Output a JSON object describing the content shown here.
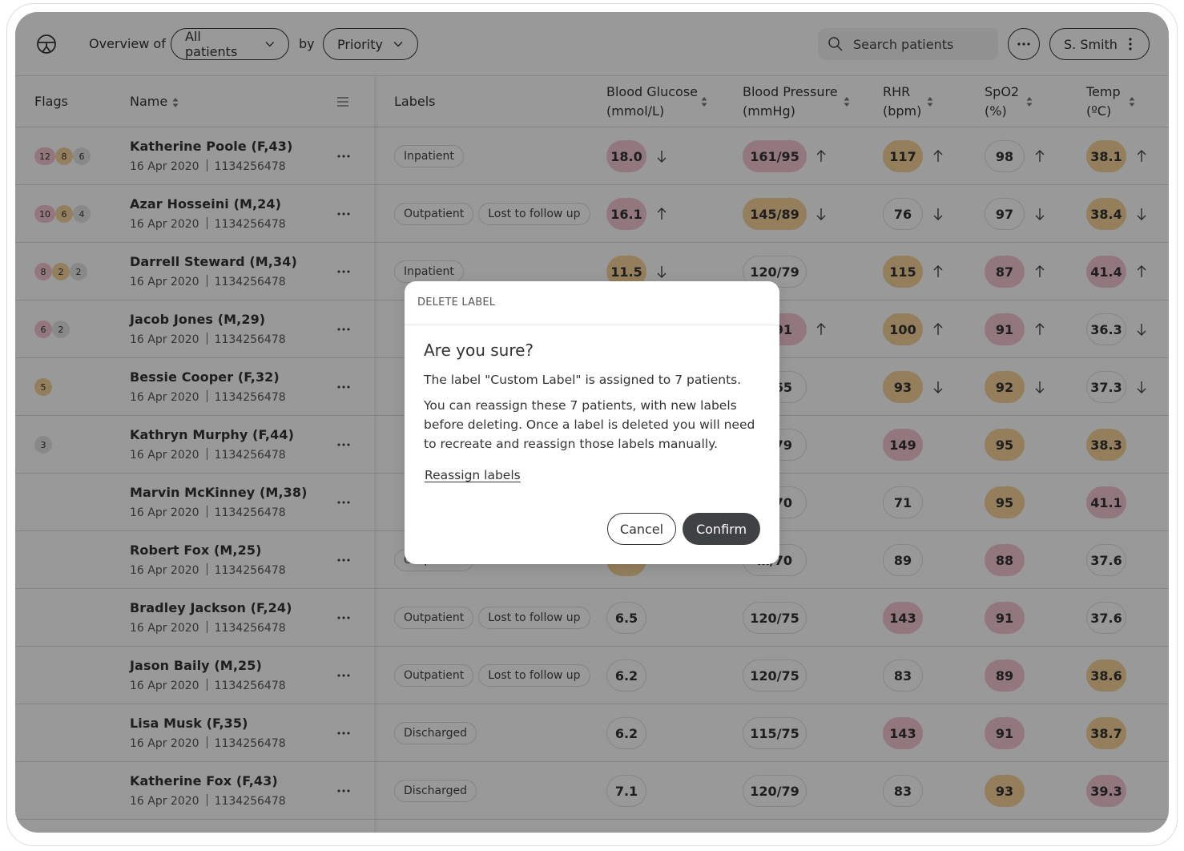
{
  "topbar": {
    "overview_label": "Overview of",
    "patients_select": "All patients",
    "by_label": "by",
    "sort_select": "Priority",
    "search_placeholder": "Search patients",
    "user_name": "S. Smith"
  },
  "table": {
    "headers": {
      "flags": "Flags",
      "name": "Name",
      "labels": "Labels",
      "blood_glucose": [
        "Blood Glucose",
        "(mmol/L)"
      ],
      "blood_pressure": [
        "Blood Pressure",
        "(mmHg)"
      ],
      "rhr": [
        "RHR",
        "(bpm)"
      ],
      "spo2": [
        "SpO2",
        "(%)"
      ],
      "temp": [
        "Temp",
        "(ºC)"
      ]
    },
    "rows": [
      {
        "name": "Katherine Poole (F,43)",
        "date": "16 Apr 2020",
        "id": "1134256478",
        "flags": [
          {
            "v": "12",
            "c": "red"
          },
          {
            "v": "8",
            "c": "amber"
          },
          {
            "v": "6",
            "c": "grey"
          }
        ],
        "labels": [
          "Inpatient"
        ],
        "bg": {
          "v": "18.0",
          "c": "red",
          "t": "down"
        },
        "bp": {
          "v": "161/95",
          "c": "red",
          "t": "up"
        },
        "rhr": {
          "v": "117",
          "c": "amber",
          "t": "up"
        },
        "spo2": {
          "v": "98",
          "c": "none",
          "t": "up"
        },
        "temp": {
          "v": "38.1",
          "c": "amber",
          "t": "up"
        }
      },
      {
        "name": "Azar Hosseini (M,24)",
        "date": "16 Apr 2020",
        "id": "1134256478",
        "flags": [
          {
            "v": "10",
            "c": "red"
          },
          {
            "v": "6",
            "c": "amber"
          },
          {
            "v": "4",
            "c": "grey"
          }
        ],
        "labels": [
          "Outpatient",
          "Lost to follow up"
        ],
        "bg": {
          "v": "16.1",
          "c": "red",
          "t": "up"
        },
        "bp": {
          "v": "145/89",
          "c": "amber",
          "t": "down"
        },
        "rhr": {
          "v": "76",
          "c": "none",
          "t": "down"
        },
        "spo2": {
          "v": "97",
          "c": "none",
          "t": "down"
        },
        "temp": {
          "v": "38.4",
          "c": "amber",
          "t": "down"
        }
      },
      {
        "name": "Darrell Steward (M,34)",
        "date": "16 Apr 2020",
        "id": "1134256478",
        "flags": [
          {
            "v": "8",
            "c": "red"
          },
          {
            "v": "2",
            "c": "amber"
          },
          {
            "v": "2",
            "c": "grey"
          }
        ],
        "labels": [
          "Inpatient"
        ],
        "bg": {
          "v": "11.5",
          "c": "amber",
          "t": "down"
        },
        "bp": {
          "v": "120/79",
          "c": "none",
          "t": ""
        },
        "rhr": {
          "v": "115",
          "c": "amber",
          "t": "up"
        },
        "spo2": {
          "v": "87",
          "c": "red",
          "t": "up"
        },
        "temp": {
          "v": "41.4",
          "c": "red",
          "t": "up"
        }
      },
      {
        "name": "Jacob Jones (M,29)",
        "date": "16 Apr 2020",
        "id": "1134256478",
        "flags": [
          {
            "v": "6",
            "c": "red"
          },
          {
            "v": "2",
            "c": "grey"
          }
        ],
        "labels": [],
        "bg": null,
        "bp": {
          "v": "…/91",
          "c": "red",
          "t": "up"
        },
        "rhr": {
          "v": "100",
          "c": "amber",
          "t": "up"
        },
        "spo2": {
          "v": "91",
          "c": "red",
          "t": "up"
        },
        "temp": {
          "v": "36.3",
          "c": "none",
          "t": "down"
        }
      },
      {
        "name": "Bessie Cooper (F,32)",
        "date": "16 Apr 2020",
        "id": "1134256478",
        "flags": [
          {
            "v": "5",
            "c": "amber"
          }
        ],
        "labels": [],
        "bg": null,
        "bp": {
          "v": "…/65",
          "c": "none",
          "t": ""
        },
        "rhr": {
          "v": "93",
          "c": "amber",
          "t": "down"
        },
        "spo2": {
          "v": "92",
          "c": "amber",
          "t": "down"
        },
        "temp": {
          "v": "37.3",
          "c": "none",
          "t": "down"
        }
      },
      {
        "name": "Kathryn Murphy (F,44)",
        "date": "16 Apr 2020",
        "id": "1134256478",
        "flags": [
          {
            "v": "3",
            "c": "grey"
          }
        ],
        "labels": [],
        "bg": null,
        "bp": {
          "v": "…/79",
          "c": "none",
          "t": ""
        },
        "rhr": {
          "v": "149",
          "c": "red",
          "t": ""
        },
        "spo2": {
          "v": "95",
          "c": "amber",
          "t": ""
        },
        "temp": {
          "v": "38.3",
          "c": "amber",
          "t": ""
        }
      },
      {
        "name": "Marvin McKinney (M,38)",
        "date": "16 Apr 2020",
        "id": "1134256478",
        "flags": [],
        "labels": [],
        "bg": null,
        "bp": {
          "v": "…/70",
          "c": "none",
          "t": ""
        },
        "rhr": {
          "v": "71",
          "c": "none",
          "t": ""
        },
        "spo2": {
          "v": "95",
          "c": "amber",
          "t": ""
        },
        "temp": {
          "v": "41.1",
          "c": "red",
          "t": ""
        }
      },
      {
        "name": "Robert Fox (M,25)",
        "date": "16 Apr 2020",
        "id": "1134256478",
        "flags": [],
        "labels": [
          "Outpatient"
        ],
        "bg": {
          "v": "",
          "c": "amber",
          "t": ""
        },
        "bp": {
          "v": "…/70",
          "c": "none",
          "t": ""
        },
        "rhr": {
          "v": "89",
          "c": "none",
          "t": ""
        },
        "spo2": {
          "v": "88",
          "c": "red",
          "t": ""
        },
        "temp": {
          "v": "37.6",
          "c": "none",
          "t": ""
        }
      },
      {
        "name": "Bradley Jackson (F,24)",
        "date": "16 Apr 2020",
        "id": "1134256478",
        "flags": [],
        "labels": [
          "Outpatient",
          "Lost to follow up"
        ],
        "bg": {
          "v": "6.5",
          "c": "none",
          "t": ""
        },
        "bp": {
          "v": "120/75",
          "c": "none",
          "t": ""
        },
        "rhr": {
          "v": "143",
          "c": "red",
          "t": ""
        },
        "spo2": {
          "v": "91",
          "c": "red",
          "t": ""
        },
        "temp": {
          "v": "37.6",
          "c": "none",
          "t": ""
        }
      },
      {
        "name": "Jason Baily (M,25)",
        "date": "16 Apr 2020",
        "id": "1134256478",
        "flags": [],
        "labels": [
          "Outpatient",
          "Lost to follow up"
        ],
        "bg": {
          "v": "6.2",
          "c": "none",
          "t": ""
        },
        "bp": {
          "v": "120/75",
          "c": "none",
          "t": ""
        },
        "rhr": {
          "v": "83",
          "c": "none",
          "t": ""
        },
        "spo2": {
          "v": "89",
          "c": "red",
          "t": ""
        },
        "temp": {
          "v": "38.6",
          "c": "amber",
          "t": ""
        }
      },
      {
        "name": "Lisa Musk (F,35)",
        "date": "16 Apr 2020",
        "id": "1134256478",
        "flags": [],
        "labels": [
          "Discharged"
        ],
        "bg": {
          "v": "6.2",
          "c": "none",
          "t": ""
        },
        "bp": {
          "v": "115/75",
          "c": "none",
          "t": ""
        },
        "rhr": {
          "v": "143",
          "c": "red",
          "t": ""
        },
        "spo2": {
          "v": "91",
          "c": "red",
          "t": ""
        },
        "temp": {
          "v": "38.7",
          "c": "amber",
          "t": ""
        }
      },
      {
        "name": "Katherine Fox (F,43)",
        "date": "16 Apr 2020",
        "id": "1134256478",
        "flags": [],
        "labels": [
          "Discharged"
        ],
        "bg": {
          "v": "7.1",
          "c": "none",
          "t": ""
        },
        "bp": {
          "v": "120/79",
          "c": "none",
          "t": ""
        },
        "rhr": {
          "v": "83",
          "c": "none",
          "t": ""
        },
        "spo2": {
          "v": "93",
          "c": "amber",
          "t": ""
        },
        "temp": {
          "v": "39.3",
          "c": "red",
          "t": ""
        }
      }
    ]
  },
  "modal": {
    "header": "DELETE LABEL",
    "title": "Are you sure?",
    "message": "The label \"Custom Label\" is assigned to 7 patients.",
    "detail": "You can reassign these 7 patients, with new labels before deleting. Once a label is deleted you will need to recreate and reassign those labels manually.",
    "link": "Reassign labels",
    "cancel": "Cancel",
    "confirm": "Confirm"
  },
  "colors": {
    "alert_red": "#f6c7d2",
    "alert_amber": "#f7d29a",
    "neutral": "#e4e4e4",
    "confirm_bg": "#404145",
    "overlay": "rgba(0,0,0,0.4)"
  }
}
